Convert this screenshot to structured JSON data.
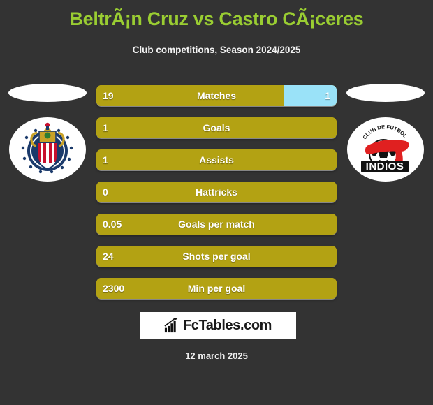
{
  "header": {
    "title": "BeltrÃ¡n Cruz vs Castro CÃ¡ceres",
    "subtitle": "Club competitions, Season 2024/2025"
  },
  "teams": {
    "left": {
      "logo_name": "chivas-guadalajara-crest",
      "alt": "Club Deportivo Guadalajara"
    },
    "right": {
      "logo_name": "indios-crest",
      "alt": "Club de Futbol Indios",
      "text_top": "CLUB DE FUTBOL",
      "text_bottom": "INDIOS"
    }
  },
  "colors": {
    "background": "#333333",
    "title": "#9acd32",
    "bar_left": "#b3a213",
    "bar_right": "#9ae2f8",
    "text": "#ffffff"
  },
  "chart_data": {
    "type": "bar",
    "title": "BeltrÃ¡n Cruz vs Castro CÃ¡ceres",
    "subtitle": "Club competitions, Season 2024/2025",
    "orientation": "horizontal-diverging",
    "categories": [
      "Matches",
      "Goals",
      "Assists",
      "Hattricks",
      "Goals per match",
      "Shots per goal",
      "Min per goal"
    ],
    "series": [
      {
        "name": "BeltrÃ¡n Cruz",
        "side": "left",
        "color": "#b3a213",
        "values": [
          "19",
          "1",
          "1",
          "0",
          "0.05",
          "24",
          "2300"
        ]
      },
      {
        "name": "Castro CÃ¡ceres",
        "side": "right",
        "color": "#9ae2f8",
        "values": [
          "1",
          "",
          "",
          "",
          "",
          "",
          ""
        ]
      }
    ]
  },
  "rows": [
    {
      "label": "Matches",
      "left_value": "19",
      "right_value": "1",
      "left_pct": 78,
      "right_pct": 22,
      "has_right": true
    },
    {
      "label": "Goals",
      "left_value": "1",
      "right_value": "",
      "left_pct": 100,
      "right_pct": 0,
      "has_right": false
    },
    {
      "label": "Assists",
      "left_value": "1",
      "right_value": "",
      "left_pct": 100,
      "right_pct": 0,
      "has_right": false
    },
    {
      "label": "Hattricks",
      "left_value": "0",
      "right_value": "",
      "left_pct": 100,
      "right_pct": 0,
      "has_right": false
    },
    {
      "label": "Goals per match",
      "left_value": "0.05",
      "right_value": "",
      "left_pct": 100,
      "right_pct": 0,
      "has_right": false
    },
    {
      "label": "Shots per goal",
      "left_value": "24",
      "right_value": "",
      "left_pct": 100,
      "right_pct": 0,
      "has_right": false
    },
    {
      "label": "Min per goal",
      "left_value": "2300",
      "right_value": "",
      "left_pct": 100,
      "right_pct": 0,
      "has_right": false
    }
  ],
  "footer": {
    "brand_text": "FcTables.com",
    "brand_icon": "bar-chart-icon",
    "date": "12 march 2025"
  }
}
